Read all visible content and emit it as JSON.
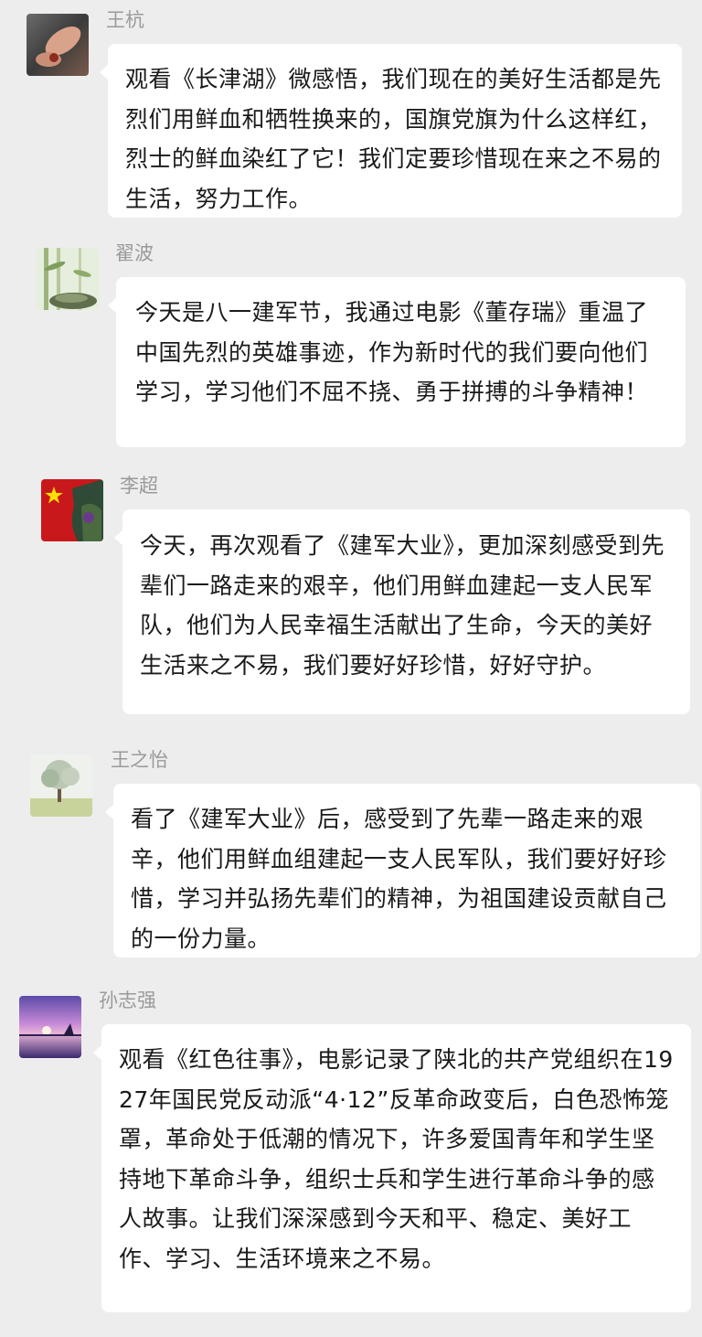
{
  "messages": [
    {
      "sender": "王杭",
      "avatar": "avatar-hand-photo",
      "text": "观看《长津湖》微感悟，我们现在的美好生活都是先烈们用鲜血和牺牲换来的，国旗党旗为什么这样红，烈士的鲜血染红了它！我们定要珍惜现在来之不易的生活，努力工作。"
    },
    {
      "sender": "翟波",
      "avatar": "avatar-bamboo-photo",
      "text": "今天是八一建军节，我通过电影《董存瑞》重温了中国先烈的英雄事迹，作为新时代的我们要向他们学习，学习他们不屈不挠、勇于拼搏的斗争精神！"
    },
    {
      "sender": "李超",
      "avatar": "avatar-flag-photo",
      "text": "今天，再次观看了《建军大业》，更加深刻感受到先辈们一路走来的艰辛，他们用鲜血建起一支人民军队，他们为人民幸福生活献出了生命，今天的美好生活来之不易，我们要好好珍惜，好好守护。"
    },
    {
      "sender": "王之怡",
      "avatar": "avatar-tree-photo",
      "text": "看了《建军大业》后，感受到了先辈一路走来的艰辛，他们用鲜血组建起一支人民军队，我们要好好珍惜，学习并弘扬先辈们的精神，为祖国建设贡献自己的一份力量。"
    },
    {
      "sender": "孙志强",
      "avatar": "avatar-sunset-photo",
      "text": "观看《红色往事》，电影记录了陕北的共产党组织在1927年国民党反动派“4·12”反革命政变后，白色恐怖笼罩，革命处于低潮的情况下，许多爱国青年和学生坚持地下革命斗争，组织士兵和学生进行革命斗争的感人故事。让我们深深感到今天和平、稳定、美好工作、学习、生活环境来之不易。"
    }
  ],
  "colors": {
    "background": "#ededed",
    "bubble": "#ffffff",
    "sender_name": "#9a9a9a",
    "text": "#1a1a1a"
  }
}
